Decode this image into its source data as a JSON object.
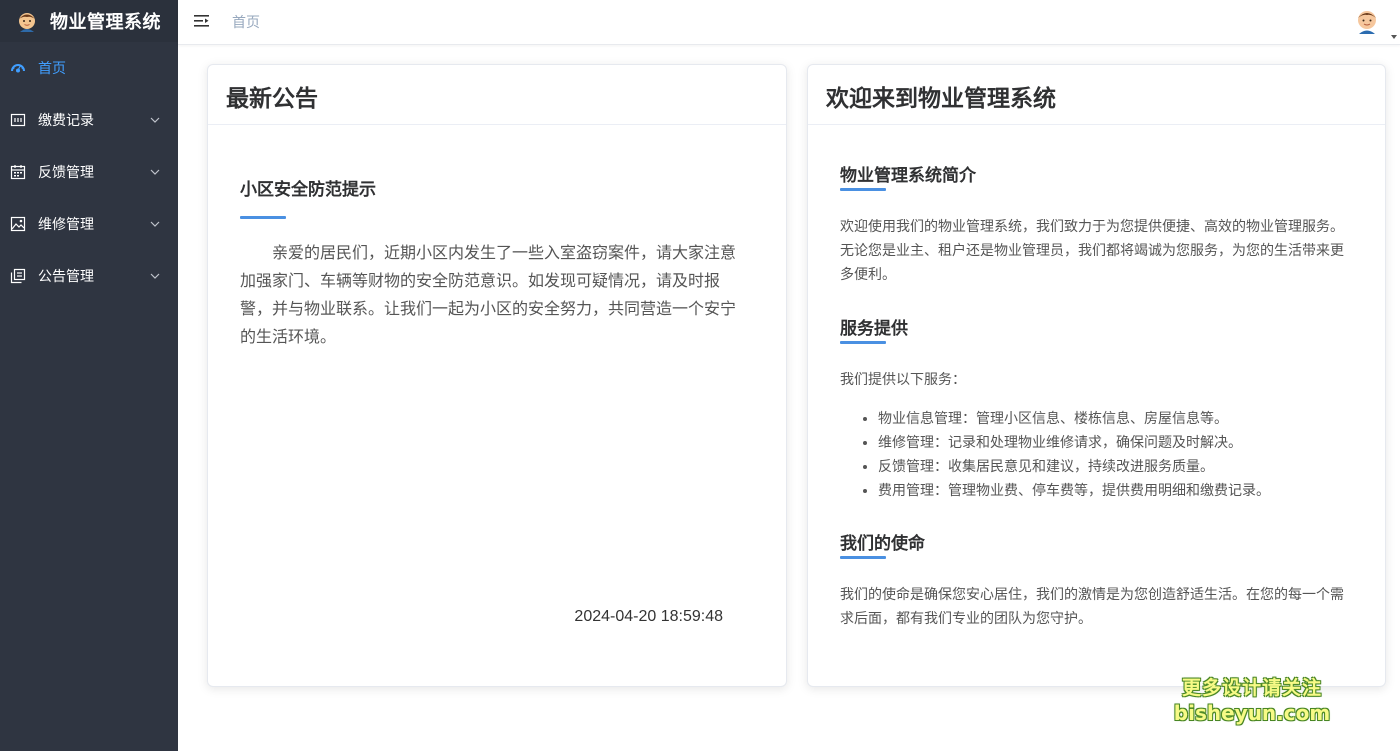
{
  "app": {
    "title": "物业管理系统",
    "logo_icon": "avatar-logo-icon"
  },
  "sidebar": {
    "items": [
      {
        "label": "首页",
        "icon": "dashboard-icon",
        "active": true
      },
      {
        "label": "缴费记录",
        "icon": "receipt-icon",
        "expandable": true
      },
      {
        "label": "反馈管理",
        "icon": "calendar-icon",
        "expandable": true
      },
      {
        "label": "维修管理",
        "icon": "picture-icon",
        "expandable": true
      },
      {
        "label": "公告管理",
        "icon": "copy-document-icon",
        "expandable": true
      }
    ],
    "active_color": "#409eff",
    "background": "#2f3541"
  },
  "header": {
    "breadcrumb": "首页",
    "menu_icon": "hamburger-icon",
    "avatar_icon": "user-avatar-icon"
  },
  "notice_card": {
    "header": "最新公告",
    "title": "小区安全防范提示",
    "body": "亲爱的居民们，近期小区内发生了一些入室盗窃案件，请大家注意加强家门、车辆等财物的安全防范意识。如发现可疑情况，请及时报警，并与物业联系。让我们一起为小区的安全努力，共同营造一个安宁的生活环境。",
    "time": "2024-04-20 18:59:48"
  },
  "welcome_card": {
    "header": "欢迎来到物业管理系统",
    "intro_title": "物业管理系统简介",
    "intro_text": "欢迎使用我们的物业管理系统，我们致力于为您提供便捷、高效的物业管理服务。无论您是业主、租户还是物业管理员，我们都将竭诚为您服务，为您的生活带来更多便利。",
    "services_title": "服务提供",
    "services_intro": "我们提供以下服务：",
    "services": [
      "物业信息管理：管理小区信息、楼栋信息、房屋信息等。",
      "维修管理：记录和处理物业维修请求，确保问题及时解决。",
      "反馈管理：收集居民意见和建议，持续改进服务质量。",
      "费用管理：管理物业费、停车费等，提供费用明细和缴费记录。"
    ],
    "mission_title": "我们的使命",
    "mission_text": "我们的使命是确保您安心居住，我们的激情是为您创造舒适生活。在您的每一个需求后面，都有我们专业的团队为您守护。"
  },
  "watermark": {
    "line1": "更多设计请关注",
    "line2": "bisheyun.com"
  }
}
